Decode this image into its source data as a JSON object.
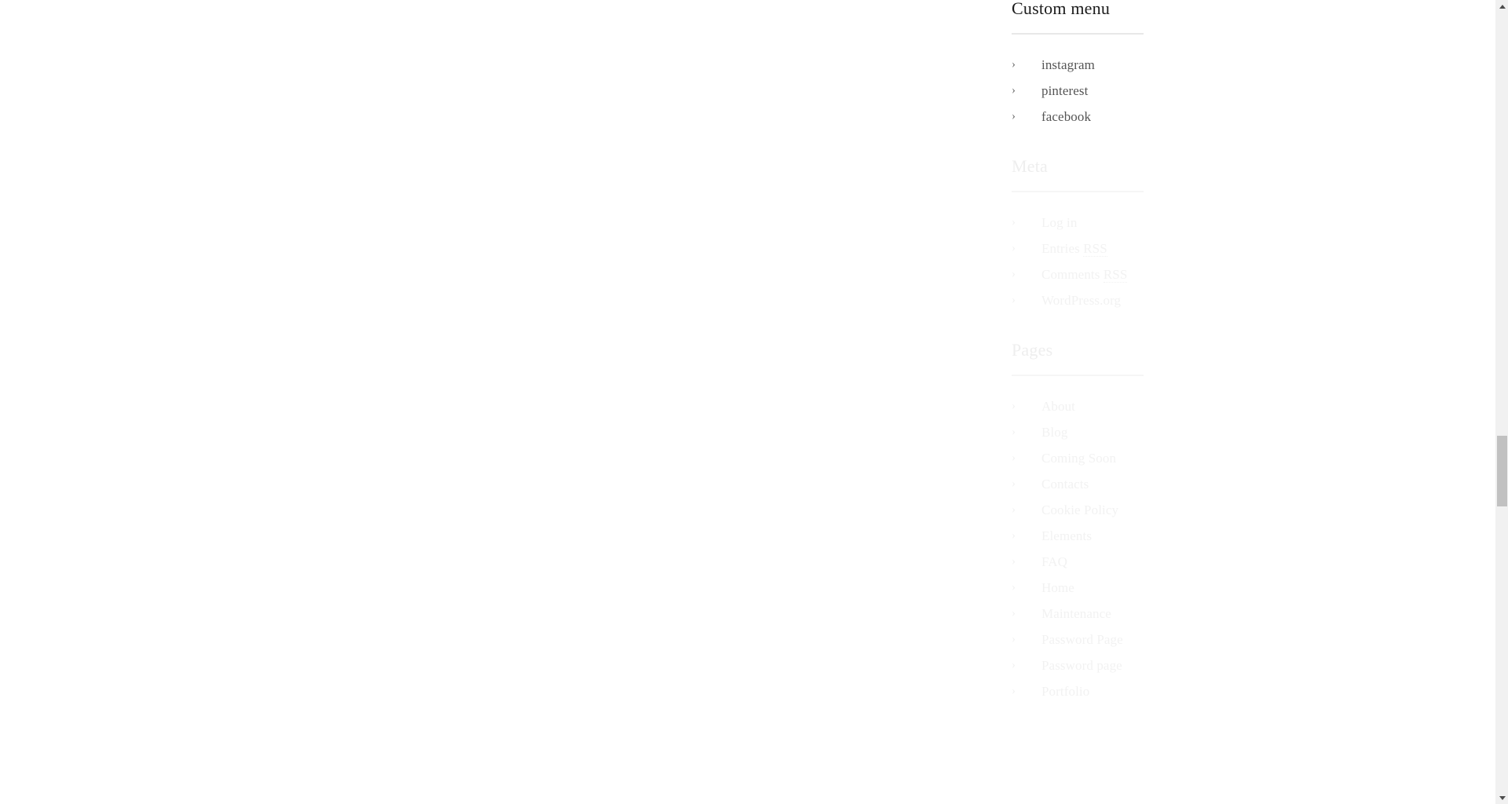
{
  "page": {
    "background_color": "#ffffff",
    "content_area_empty": true
  },
  "sidebar": {
    "widgets": [
      {
        "id": "custom-menu",
        "title": "Custom menu",
        "faded": false,
        "items": [
          {
            "label": "instagram",
            "bullet": "chevron-right-icon"
          },
          {
            "label": "pinterest",
            "bullet": "chevron-right-icon"
          },
          {
            "label": "facebook",
            "bullet": "chevron-right-icon"
          }
        ]
      },
      {
        "id": "meta",
        "title": "Meta",
        "faded": true,
        "items": [
          {
            "label": "Log in",
            "bullet": "chevron-right-icon"
          },
          {
            "label": "Entries RSS",
            "bullet": "chevron-right-icon",
            "abbr": "RSS"
          },
          {
            "label": "Comments RSS",
            "bullet": "chevron-right-icon",
            "abbr": "RSS"
          },
          {
            "label": "WordPress.org",
            "bullet": "chevron-right-icon"
          }
        ]
      },
      {
        "id": "pages",
        "title": "Pages",
        "faded": true,
        "items": [
          {
            "label": "About",
            "bullet": "chevron-right-icon"
          },
          {
            "label": "Blog",
            "bullet": "chevron-right-icon"
          },
          {
            "label": "Coming Soon",
            "bullet": "chevron-right-icon"
          },
          {
            "label": "Contacts",
            "bullet": "chevron-right-icon"
          },
          {
            "label": "Cookie Policy",
            "bullet": "chevron-right-icon"
          },
          {
            "label": "Elements",
            "bullet": "chevron-right-icon"
          },
          {
            "label": "FAQ",
            "bullet": "chevron-right-icon"
          },
          {
            "label": "Home",
            "bullet": "chevron-right-icon"
          },
          {
            "label": "Maintenance",
            "bullet": "chevron-right-icon"
          },
          {
            "label": "Password Page",
            "bullet": "chevron-right-icon"
          },
          {
            "label": "Password page",
            "bullet": "chevron-right-icon"
          },
          {
            "label": "Portfolio",
            "bullet": "chevron-right-icon"
          }
        ]
      }
    ]
  },
  "scrollbar": {
    "up_arrow": "scroll-up-arrow-icon",
    "down_arrow": "scroll-down-arrow-icon",
    "track_color": "#f1f1f1",
    "thumb_color": "#c1c1c1"
  },
  "colors": {
    "text_primary": "#1b1b1b",
    "text_link": "#555555",
    "text_faded": "#f2f2f2",
    "rule": "#e8e8e8",
    "background": "#ffffff"
  },
  "glyphs": {
    "chevron_right": "›"
  }
}
